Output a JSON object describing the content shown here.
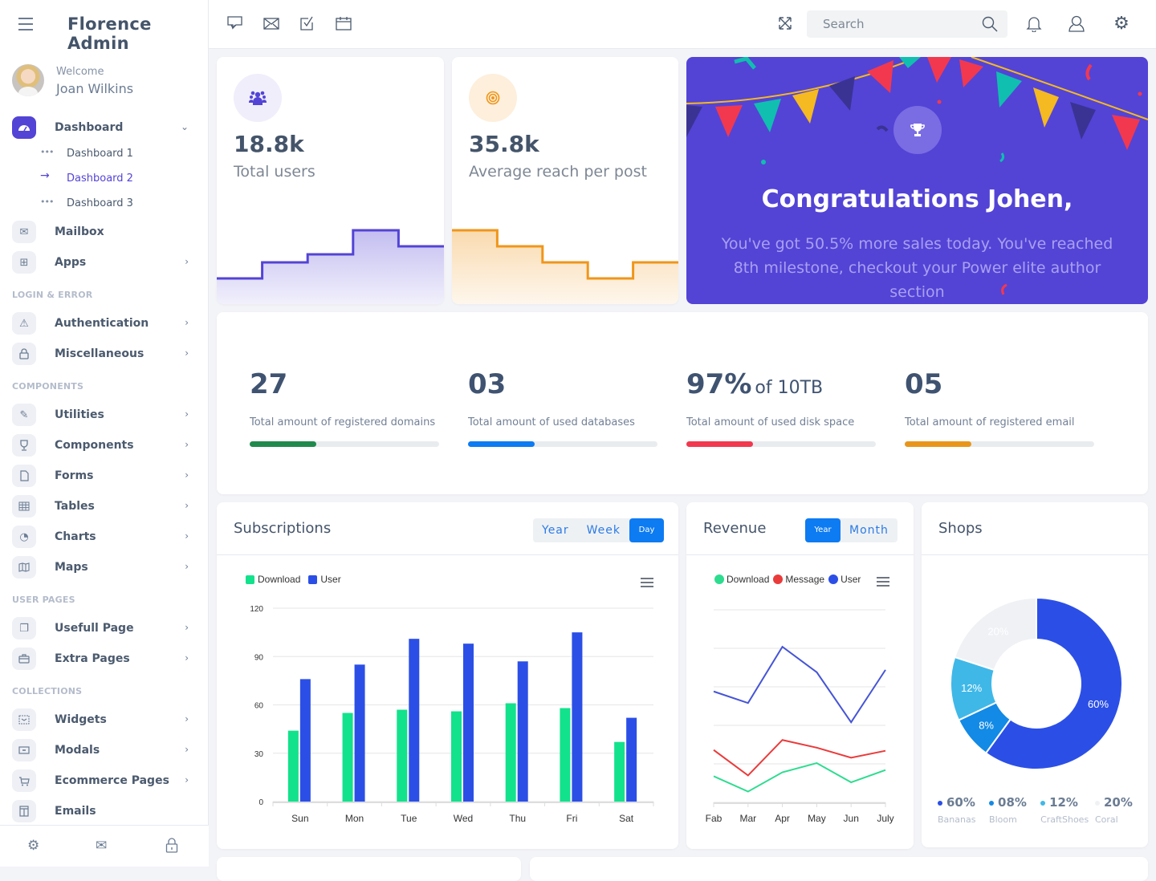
{
  "app": {
    "title": "Florence Admin"
  },
  "user": {
    "greeting": "Welcome",
    "name": "Joan Wilkins"
  },
  "sidebar": {
    "dashboard": {
      "label": "Dashboard",
      "icon": "speedometer-icon",
      "children": [
        {
          "label": "Dashboard 1",
          "active": false
        },
        {
          "label": "Dashboard 2",
          "active": true
        },
        {
          "label": "Dashboard 3",
          "active": false
        }
      ]
    },
    "items": [
      {
        "label": "Mailbox",
        "icon": "mail-icon",
        "arrow": false
      },
      {
        "label": "Apps",
        "icon": "grid-icon",
        "arrow": true
      }
    ],
    "sections": [
      {
        "title": "LOGIN & ERROR",
        "items": [
          {
            "label": "Authentication",
            "icon": "warning-icon"
          },
          {
            "label": "Miscellaneous",
            "icon": "lock-icon"
          }
        ]
      },
      {
        "title": "COMPONENTS",
        "items": [
          {
            "label": "Utilities",
            "icon": "edit-icon"
          },
          {
            "label": "Components",
            "icon": "trophy-icon"
          },
          {
            "label": "Forms",
            "icon": "file-icon"
          },
          {
            "label": "Tables",
            "icon": "table-icon"
          },
          {
            "label": "Charts",
            "icon": "pie-chart-icon"
          },
          {
            "label": "Maps",
            "icon": "map-icon"
          }
        ]
      },
      {
        "title": "USER PAGES",
        "items": [
          {
            "label": "Usefull Page",
            "icon": "copy-icon"
          },
          {
            "label": "Extra Pages",
            "icon": "briefcase-icon"
          }
        ]
      },
      {
        "title": "COLLECTIONS",
        "items": [
          {
            "label": "Widgets",
            "icon": "widget-icon"
          },
          {
            "label": "Modals",
            "icon": "modal-icon"
          },
          {
            "label": "Ecommerce Pages",
            "icon": "cart-icon"
          },
          {
            "label": "Emails",
            "icon": "email-template-icon"
          }
        ]
      }
    ],
    "footer": [
      "settings-icon",
      "mail-icon",
      "lock-icon"
    ]
  },
  "topbar": {
    "icons": [
      "chat-icon",
      "mail-icon",
      "checkbox-icon",
      "calendar-icon"
    ],
    "search_placeholder": "Search",
    "search_value": "",
    "right_icons": [
      "fullscreen-icon",
      "bell-icon",
      "user-icon",
      "settings-icon"
    ]
  },
  "stats": [
    {
      "value": "18.8k",
      "label": "Total users",
      "icon": "users-icon",
      "color": "#5344d6",
      "bg": "#efeefa",
      "trend": [
        1,
        2,
        2.5,
        4,
        3
      ]
    },
    {
      "value": "35.8k",
      "label": "Average reach per post",
      "icon": "target-icon",
      "color": "#f0961a",
      "bg": "#fdefdc",
      "trend": [
        4,
        3,
        2,
        1,
        2
      ]
    }
  ],
  "congrats": {
    "title": "Congratulations Johen,",
    "text": "You've got 50.5% more sales today. You've reached 8th milestone, checkout your Power elite author section",
    "icon": "trophy-icon",
    "bg": "#5344d6"
  },
  "metrics": [
    {
      "value": "27",
      "suffix": "",
      "label": "Total amount of registered domains",
      "progress": 35,
      "color": "#1f8a4c"
    },
    {
      "value": "03",
      "suffix": "",
      "label": "Total amount of used databases",
      "progress": 35,
      "color": "#0d7bf2"
    },
    {
      "value": "97%",
      "suffix": "of 10TB",
      "label": "Total amount of used disk space",
      "progress": 35,
      "color": "#f2384f"
    },
    {
      "value": "05",
      "suffix": "",
      "label": "Total amount of registered email",
      "progress": 35,
      "color": "#e8961b"
    }
  ],
  "subscriptions": {
    "title": "Subscriptions",
    "toggle": [
      {
        "label": "Year",
        "active": false
      },
      {
        "label": "Week",
        "active": false
      },
      {
        "label": "Day",
        "active": true
      }
    ]
  },
  "revenue": {
    "title": "Revenue",
    "toggle": [
      {
        "label": "Year",
        "active": true
      },
      {
        "label": "Month",
        "active": false
      }
    ]
  },
  "shops": {
    "title": "Shops",
    "legend": [
      {
        "value": "60%",
        "name": "Bananas",
        "color": "#2b4fe6"
      },
      {
        "value": "08%",
        "name": "Bloom",
        "color": "#128ae6"
      },
      {
        "value": "12%",
        "name": "CraftShoes",
        "color": "#3fb8e8"
      },
      {
        "value": "20%",
        "name": "Coral",
        "color": "#eff1f5"
      }
    ]
  },
  "chart_data": [
    {
      "type": "bar",
      "title": "Subscriptions",
      "categories": [
        "Sun",
        "Mon",
        "Tue",
        "Wed",
        "Thu",
        "Fri",
        "Sat"
      ],
      "series": [
        {
          "name": "Download",
          "color": "#12e28c",
          "values": [
            44,
            55,
            57,
            56,
            61,
            58,
            37
          ]
        },
        {
          "name": "User",
          "color": "#2b4fe6",
          "values": [
            76,
            85,
            101,
            98,
            87,
            105,
            52
          ]
        }
      ],
      "yticks": [
        0,
        30,
        60,
        90,
        120
      ],
      "ylim": [
        0,
        120
      ],
      "legend": "top-left",
      "grid": true,
      "xlabel": "",
      "ylabel": ""
    },
    {
      "type": "line",
      "title": "Revenue",
      "categories": [
        "Fab",
        "Mar",
        "Apr",
        "May",
        "Jun",
        "July"
      ],
      "series": [
        {
          "name": "Download",
          "color": "#2ddc8f",
          "values": [
            34,
            14,
            39,
            51,
            26,
            42
          ]
        },
        {
          "name": "Message",
          "color": "#ea3b3b",
          "values": [
            68,
            35,
            81,
            71,
            58,
            67
          ]
        },
        {
          "name": "User",
          "color": "#4655d6",
          "values": [
            144,
            129,
            202,
            169,
            104,
            172
          ]
        }
      ],
      "ylim": [
        0,
        250
      ],
      "grid": true,
      "legend": "top-center",
      "xlabel": "",
      "ylabel": ""
    },
    {
      "type": "pie",
      "title": "Shops",
      "labels": [
        "Bananas",
        "Bloom",
        "CraftShoes",
        "Coral"
      ],
      "values": [
        60,
        8,
        12,
        20
      ],
      "colors": [
        "#2b4fe6",
        "#128ae6",
        "#3fb8e8",
        "#eff1f5"
      ],
      "donut": true
    }
  ]
}
